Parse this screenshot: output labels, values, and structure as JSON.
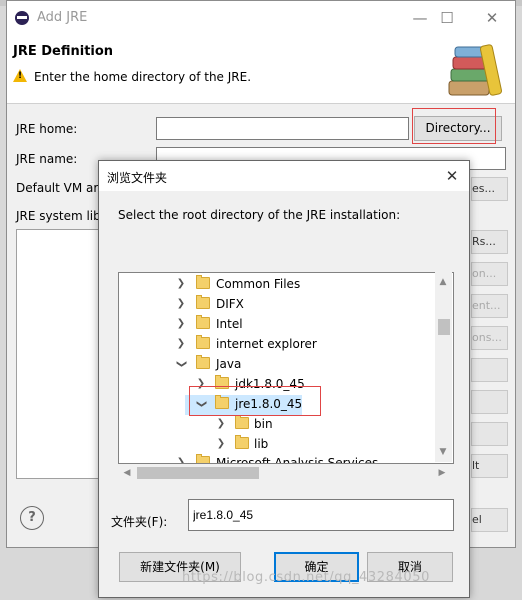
{
  "add_jre": {
    "title": "Add JRE",
    "heading": "JRE Definition",
    "description": "Enter the home directory of the JRE.",
    "labels": {
      "jre_home": "JRE home:",
      "jre_name": "JRE name:",
      "default_vm": "Default VM ar",
      "system_libs": "JRE system lib"
    },
    "jre_home_value": "",
    "jre_name_value": "",
    "directory_button": "Directory...",
    "side_buttons": [
      "es...",
      "Rs...",
      "on...",
      "ent...",
      "ons...",
      "",
      "",
      "",
      "lt",
      "el"
    ]
  },
  "browse": {
    "title": "浏览文件夹",
    "prompt": "Select the root directory of the JRE installation:",
    "tree": [
      {
        "label": "Common Files",
        "expanded": false
      },
      {
        "label": "DIFX",
        "expanded": false
      },
      {
        "label": "Intel",
        "expanded": false
      },
      {
        "label": "internet explorer",
        "expanded": false
      },
      {
        "label": "Java",
        "expanded": true
      },
      {
        "label": "jdk1.8.0_45",
        "expanded": false
      },
      {
        "label": "jre1.8.0_45",
        "expanded": true,
        "selected": true
      },
      {
        "label": "bin",
        "expanded": false
      },
      {
        "label": "lib",
        "expanded": false
      },
      {
        "label": "Microsoft Analysis Services",
        "expanded": false
      }
    ],
    "folder_label": "文件夹(F):",
    "folder_value": "jre1.8.0_45",
    "new_folder_button": "新建文件夹(M)",
    "ok_button": "确定",
    "cancel_button": "取消"
  },
  "watermark": "https://blog.csdn.net/qq_43284050"
}
